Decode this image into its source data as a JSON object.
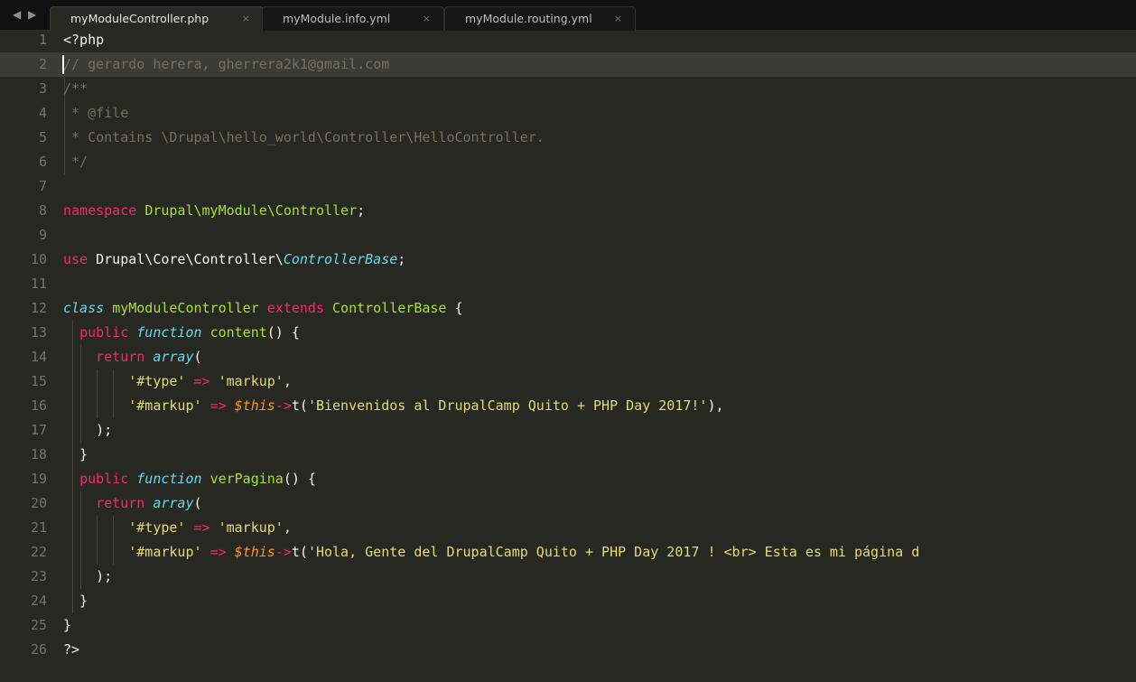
{
  "nav_arrows": "◀ ▶",
  "tabs": [
    {
      "label": "myModuleController.php",
      "close": "×",
      "active": true
    },
    {
      "label": "myModule.info.yml",
      "close": "×",
      "active": false
    },
    {
      "label": "myModule.routing.yml",
      "close": "×",
      "active": false
    }
  ],
  "current_line": 2,
  "lines": [
    {
      "n": "1",
      "tokens": [
        {
          "t": "<?php",
          "s": "pun"
        }
      ]
    },
    {
      "n": "2",
      "tokens": [
        {
          "t": "// gerardo herera, gherrera2k1@gmail.com",
          "s": "c"
        }
      ]
    },
    {
      "n": "3",
      "tokens": [
        {
          "t": "/**",
          "s": "c"
        }
      ]
    },
    {
      "n": "4",
      "tokens": [
        {
          "t": " * @file",
          "s": "c"
        }
      ]
    },
    {
      "n": "5",
      "tokens": [
        {
          "t": " * Contains \\Drupal\\hello_world\\Controller\\HelloController.",
          "s": "c"
        }
      ]
    },
    {
      "n": "6",
      "tokens": [
        {
          "t": " */",
          "s": "c"
        }
      ]
    },
    {
      "n": "7",
      "tokens": []
    },
    {
      "n": "8",
      "tokens": [
        {
          "t": "namespace ",
          "s": "kw"
        },
        {
          "t": "Drupal\\myModule\\Controller",
          "s": "ns"
        },
        {
          "t": ";",
          "s": "pun"
        }
      ]
    },
    {
      "n": "9",
      "tokens": []
    },
    {
      "n": "10",
      "tokens": [
        {
          "t": "use ",
          "s": "kw"
        },
        {
          "t": "Drupal\\Core\\Controller\\",
          "s": "pun"
        },
        {
          "t": "ControllerBase",
          "s": "it"
        },
        {
          "t": ";",
          "s": "pun"
        }
      ]
    },
    {
      "n": "11",
      "tokens": []
    },
    {
      "n": "12",
      "tokens": [
        {
          "t": "class ",
          "s": "it"
        },
        {
          "t": "myModuleController ",
          "s": "ns"
        },
        {
          "t": "extends ",
          "s": "kw"
        },
        {
          "t": "ControllerBase",
          "s": "ns"
        },
        {
          "t": " {",
          "s": "pun"
        }
      ]
    },
    {
      "n": "13",
      "tokens": [
        {
          "t": "  ",
          "s": "pun"
        },
        {
          "t": "public ",
          "s": "kw"
        },
        {
          "t": "function ",
          "s": "it"
        },
        {
          "t": "content",
          "s": "ns"
        },
        {
          "t": "() {",
          "s": "pun"
        }
      ]
    },
    {
      "n": "14",
      "tokens": [
        {
          "t": "    ",
          "s": "pun"
        },
        {
          "t": "return ",
          "s": "kw"
        },
        {
          "t": "array",
          "s": "it"
        },
        {
          "t": "(",
          "s": "pun"
        }
      ]
    },
    {
      "n": "15",
      "tokens": [
        {
          "t": "        ",
          "s": "pun"
        },
        {
          "t": "'#type'",
          "s": "str"
        },
        {
          "t": " => ",
          "s": "kw"
        },
        {
          "t": "'markup'",
          "s": "str"
        },
        {
          "t": ",",
          "s": "pun"
        }
      ]
    },
    {
      "n": "16",
      "tokens": [
        {
          "t": "        ",
          "s": "pun"
        },
        {
          "t": "'#markup'",
          "s": "str"
        },
        {
          "t": " => ",
          "s": "kw"
        },
        {
          "t": "$this",
          "s": "vr"
        },
        {
          "t": "->",
          "s": "kw"
        },
        {
          "t": "t(",
          "s": "pun"
        },
        {
          "t": "'Bienvenidos al DrupalCamp Quito + PHP Day 2017!'",
          "s": "str"
        },
        {
          "t": "),",
          "s": "pun"
        }
      ]
    },
    {
      "n": "17",
      "tokens": [
        {
          "t": "    );",
          "s": "pun"
        }
      ]
    },
    {
      "n": "18",
      "tokens": [
        {
          "t": "  }",
          "s": "pun"
        }
      ]
    },
    {
      "n": "19",
      "tokens": [
        {
          "t": "  ",
          "s": "pun"
        },
        {
          "t": "public ",
          "s": "kw"
        },
        {
          "t": "function ",
          "s": "it"
        },
        {
          "t": "verPagina",
          "s": "ns"
        },
        {
          "t": "() {",
          "s": "pun"
        }
      ]
    },
    {
      "n": "20",
      "tokens": [
        {
          "t": "    ",
          "s": "pun"
        },
        {
          "t": "return ",
          "s": "kw"
        },
        {
          "t": "array",
          "s": "it"
        },
        {
          "t": "(",
          "s": "pun"
        }
      ]
    },
    {
      "n": "21",
      "tokens": [
        {
          "t": "        ",
          "s": "pun"
        },
        {
          "t": "'#type'",
          "s": "str"
        },
        {
          "t": " => ",
          "s": "kw"
        },
        {
          "t": "'markup'",
          "s": "str"
        },
        {
          "t": ",",
          "s": "pun"
        }
      ]
    },
    {
      "n": "22",
      "tokens": [
        {
          "t": "        ",
          "s": "pun"
        },
        {
          "t": "'#markup'",
          "s": "str"
        },
        {
          "t": " => ",
          "s": "kw"
        },
        {
          "t": "$this",
          "s": "vr"
        },
        {
          "t": "->",
          "s": "kw"
        },
        {
          "t": "t(",
          "s": "pun"
        },
        {
          "t": "'Hola, Gente del DrupalCamp Quito + PHP Day 2017 ! <br> Esta es mi página d",
          "s": "str"
        }
      ]
    },
    {
      "n": "23",
      "tokens": [
        {
          "t": "    );",
          "s": "pun"
        }
      ]
    },
    {
      "n": "24",
      "tokens": [
        {
          "t": "  }",
          "s": "pun"
        }
      ]
    },
    {
      "n": "25",
      "tokens": [
        {
          "t": "}",
          "s": "pun"
        }
      ]
    },
    {
      "n": "26",
      "tokens": [
        {
          "t": "?>",
          "s": "pun"
        }
      ]
    }
  ],
  "colors": {
    "background": "#272822",
    "tabbar": "#111111",
    "current_line": "#3b3c35",
    "gutter_text": "#75746a",
    "comment": "#75715e",
    "keyword": "#f92672",
    "name": "#a6e22e",
    "type_italic": "#66d9ef",
    "string": "#e6db74",
    "variable": "#fd971f",
    "text": "#f8f8f2"
  }
}
